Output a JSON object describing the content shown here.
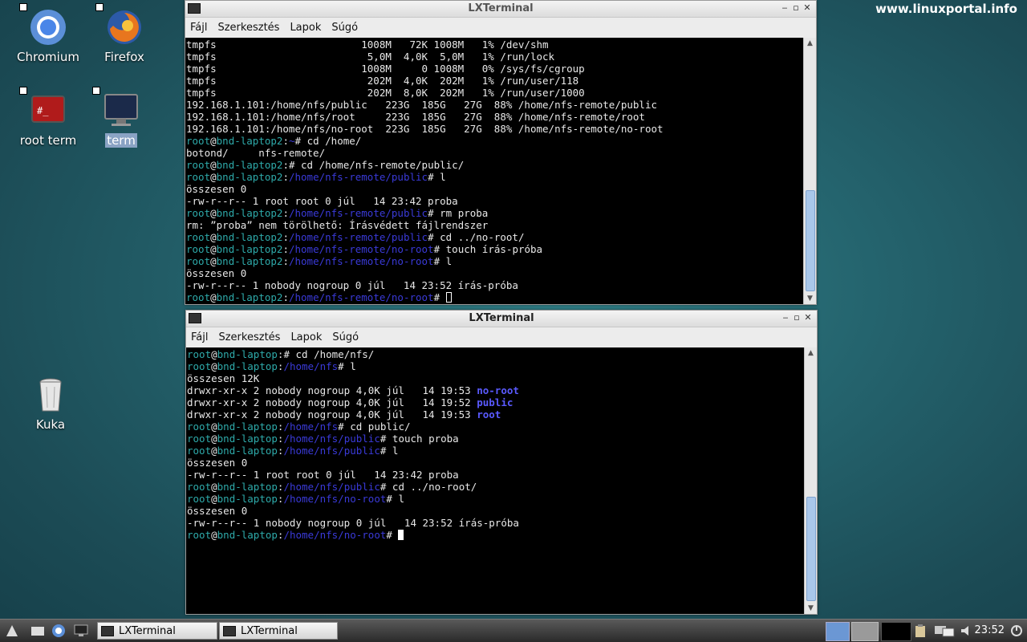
{
  "watermark": "www.linuxportal.info",
  "desktop": {
    "icons": [
      {
        "label": "Chromium",
        "icon": "chromium-icon"
      },
      {
        "label": "Firefox",
        "icon": "firefox-icon"
      },
      {
        "label": "root term",
        "icon": "root-terminal-icon"
      },
      {
        "label": "term",
        "icon": "terminal-icon"
      },
      {
        "label": "Kuka",
        "icon": "trash-icon"
      }
    ]
  },
  "windows": [
    {
      "title": "LXTerminal",
      "menu": [
        "Fájl",
        "Szerkesztés",
        "Lapok",
        "Súgó"
      ]
    },
    {
      "title": "LXTerminal",
      "menu": [
        "Fájl",
        "Szerkesztés",
        "Lapok",
        "Súgó"
      ]
    }
  ],
  "terminal1": {
    "lines": [
      {
        "t": "out",
        "text": "tmpfs                        1008M   72K 1008M   1% /dev/shm"
      },
      {
        "t": "out",
        "text": "tmpfs                         5,0M  4,0K  5,0M   1% /run/lock"
      },
      {
        "t": "out",
        "text": "tmpfs                        1008M     0 1008M   0% /sys/fs/cgroup"
      },
      {
        "t": "out",
        "text": "tmpfs                         202M  4,0K  202M   1% /run/user/118"
      },
      {
        "t": "out",
        "text": "tmpfs                         202M  8,0K  202M   1% /run/user/1000"
      },
      {
        "t": "out",
        "text": "192.168.1.101:/home/nfs/public   223G  185G   27G  88% /home/nfs-remote/public"
      },
      {
        "t": "out",
        "text": "192.168.1.101:/home/nfs/root     223G  185G   27G  88% /home/nfs-remote/root"
      },
      {
        "t": "out",
        "text": "192.168.1.101:/home/nfs/no-root  223G  185G   27G  88% /home/nfs-remote/no-root"
      },
      {
        "t": "prompt",
        "user": "root",
        "host": "bnd-laptop2",
        "path": "~",
        "cmd": "cd /home/"
      },
      {
        "t": "out",
        "text": "botond/     nfs-remote/"
      },
      {
        "t": "prompt",
        "user": "root",
        "host": "bnd-laptop2",
        "path": "",
        "cmd": "cd /home/nfs-remote/public/"
      },
      {
        "t": "prompt",
        "user": "root",
        "host": "bnd-laptop2",
        "path": "/home/nfs-remote/public",
        "cmd": "l"
      },
      {
        "t": "out",
        "text": "összesen 0"
      },
      {
        "t": "out",
        "text": "-rw-r--r-- 1 root root 0 júl   14 23:42 proba"
      },
      {
        "t": "prompt",
        "user": "root",
        "host": "bnd-laptop2",
        "path": "/home/nfs-remote/public",
        "cmd": "rm proba"
      },
      {
        "t": "out",
        "text": "rm: ”proba” nem törölhető: Írásvédett fájlrendszer"
      },
      {
        "t": "prompt",
        "user": "root",
        "host": "bnd-laptop2",
        "path": "/home/nfs-remote/public",
        "cmd": "cd ../no-root/"
      },
      {
        "t": "prompt",
        "user": "root",
        "host": "bnd-laptop2",
        "path": "/home/nfs-remote/no-root",
        "cmd": "touch írás-próba"
      },
      {
        "t": "prompt",
        "user": "root",
        "host": "bnd-laptop2",
        "path": "/home/nfs-remote/no-root",
        "cmd": "l"
      },
      {
        "t": "out",
        "text": "összesen 0"
      },
      {
        "t": "out",
        "text": "-rw-r--r-- 1 nobody nogroup 0 júl   14 23:52 írás-próba"
      },
      {
        "t": "prompt",
        "user": "root",
        "host": "bnd-laptop2",
        "path": "/home/nfs-remote/no-root",
        "cmd": "",
        "cursor": "hollow"
      }
    ]
  },
  "terminal2": {
    "lines": [
      {
        "t": "prompt",
        "user": "root",
        "host": "bnd-laptop",
        "path": "",
        "cmd": "cd /home/nfs/"
      },
      {
        "t": "prompt",
        "user": "root",
        "host": "bnd-laptop",
        "path": "/home/nfs",
        "cmd": "l"
      },
      {
        "t": "out",
        "text": "összesen 12K"
      },
      {
        "t": "dir",
        "text": "drwxr-xr-x 2 nobody nogroup 4,0K júl   14 19:53 ",
        "name": "no-root"
      },
      {
        "t": "dir",
        "text": "drwxr-xr-x 2 nobody nogroup 4,0K júl   14 19:52 ",
        "name": "public"
      },
      {
        "t": "dir",
        "text": "drwxr-xr-x 2 nobody nogroup 4,0K júl   14 19:53 ",
        "name": "root"
      },
      {
        "t": "prompt",
        "user": "root",
        "host": "bnd-laptop",
        "path": "/home/nfs",
        "cmd": "cd public/"
      },
      {
        "t": "prompt",
        "user": "root",
        "host": "bnd-laptop",
        "path": "/home/nfs/public",
        "cmd": "touch proba"
      },
      {
        "t": "prompt",
        "user": "root",
        "host": "bnd-laptop",
        "path": "/home/nfs/public",
        "cmd": "l"
      },
      {
        "t": "out",
        "text": "összesen 0"
      },
      {
        "t": "out",
        "text": "-rw-r--r-- 1 root root 0 júl   14 23:42 proba"
      },
      {
        "t": "prompt",
        "user": "root",
        "host": "bnd-laptop",
        "path": "/home/nfs/public",
        "cmd": "cd ../no-root/"
      },
      {
        "t": "prompt",
        "user": "root",
        "host": "bnd-laptop",
        "path": "/home/nfs/no-root",
        "cmd": "l"
      },
      {
        "t": "out",
        "text": "összesen 0"
      },
      {
        "t": "out",
        "text": "-rw-r--r-- 1 nobody nogroup 0 júl   14 23:52 írás-próba"
      },
      {
        "t": "prompt",
        "user": "root",
        "host": "bnd-laptop",
        "path": "/home/nfs/no-root",
        "cmd": "",
        "cursor": "solid"
      }
    ]
  },
  "taskbar": {
    "tasks": [
      {
        "label": "LXTerminal"
      },
      {
        "label": "LXTerminal"
      }
    ],
    "clock": "23:52"
  }
}
